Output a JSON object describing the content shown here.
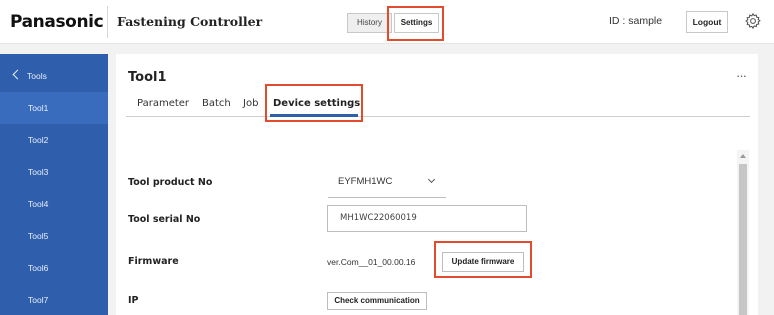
{
  "header": {
    "brand": "Panasonic",
    "app_title": "Fastening Controller",
    "history_label": "History",
    "settings_label": "Settings",
    "user_id": "ID : sample",
    "logout_label": "Logout",
    "gear_icon": "gear-icon"
  },
  "sidebar": {
    "back_label": "Tools",
    "items": [
      {
        "label": "Tool1",
        "active": true
      },
      {
        "label": "Tool2"
      },
      {
        "label": "Tool3"
      },
      {
        "label": "Tool4"
      },
      {
        "label": "Tool5"
      },
      {
        "label": "Tool6"
      },
      {
        "label": "Tool7"
      }
    ]
  },
  "main": {
    "title": "Tool1",
    "more_label": "···",
    "tabs": [
      {
        "label": "Parameter"
      },
      {
        "label": "Batch"
      },
      {
        "label": "Job"
      },
      {
        "label": "Device settings",
        "active": true
      }
    ],
    "fields": {
      "product_no_label": "Tool product No",
      "product_no_value": "EYFMH1WC",
      "serial_no_label": "Tool serial No",
      "serial_no_value": "MH1WC22060019",
      "firmware_label": "Firmware",
      "firmware_value": "ver.Com__01_00.00.16",
      "update_firmware_label": "Update firmware",
      "ip_label": "IP",
      "check_communication_label": "Check communication"
    }
  },
  "colors": {
    "sidebar": "#2f5fac",
    "highlight": "#e24b2d",
    "tab_underline": "#2f5fac"
  }
}
